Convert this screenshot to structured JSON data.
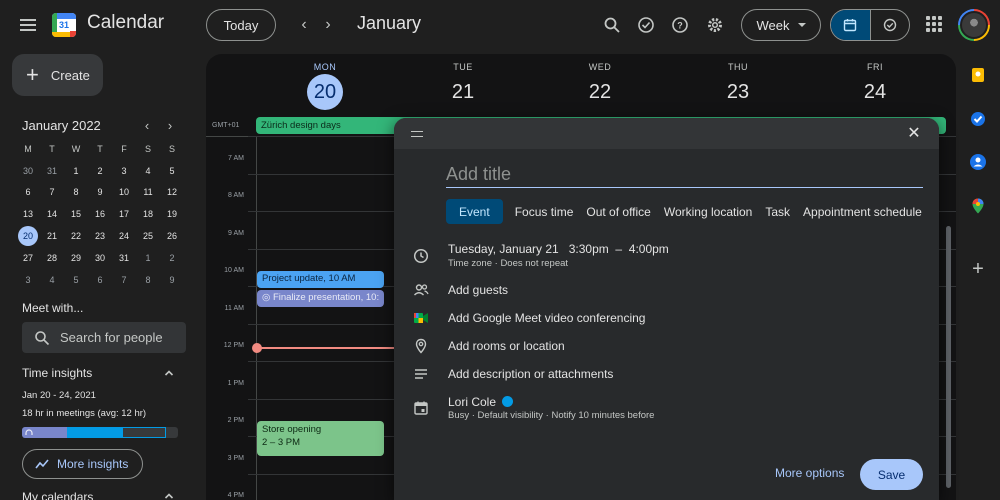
{
  "app": {
    "title": "Calendar",
    "logo_number": "31"
  },
  "toolbar": {
    "today_label": "Today",
    "prev_label": "‹",
    "next_label": "›",
    "month_title": "January",
    "view_label": "Week"
  },
  "sidebar": {
    "create_label": "Create",
    "mini_cal": {
      "title": "January 2022",
      "prev": "‹",
      "next": "›",
      "weekdays": [
        "M",
        "T",
        "W",
        "T",
        "F",
        "S",
        "S"
      ],
      "weeks": [
        [
          "30",
          "31",
          "1",
          "2",
          "3",
          "4",
          "5"
        ],
        [
          "6",
          "7",
          "8",
          "9",
          "10",
          "11",
          "12"
        ],
        [
          "13",
          "14",
          "15",
          "16",
          "17",
          "18",
          "19"
        ],
        [
          "20",
          "21",
          "22",
          "23",
          "24",
          "25",
          "26"
        ],
        [
          "27",
          "28",
          "29",
          "30",
          "31",
          "1",
          "2"
        ],
        [
          "3",
          "4",
          "5",
          "6",
          "7",
          "8",
          "9"
        ]
      ],
      "selected": "20"
    },
    "meet_with": {
      "label": "Meet with...",
      "search_placeholder": "Search for people"
    },
    "time_insights": {
      "label": "Time insights",
      "date_range": "Jan 20 - 24, 2021",
      "summary": "18 hr in meetings (avg: 12 hr)",
      "more_label": "More insights"
    },
    "my_calendars_label": "My calendars"
  },
  "week": {
    "days": [
      {
        "dow": "MON",
        "num": "20",
        "today": true
      },
      {
        "dow": "TUE",
        "num": "21"
      },
      {
        "dow": "WED",
        "num": "22"
      },
      {
        "dow": "THU",
        "num": "23"
      },
      {
        "dow": "FRI",
        "num": "24"
      }
    ],
    "timezone": "GMT+01",
    "allday_event": "Zürich design days",
    "hours": [
      "7 AM",
      "8 AM",
      "9 AM",
      "10 AM",
      "11 AM",
      "12 PM",
      "1 PM",
      "2 PM",
      "3 PM",
      "4 PM"
    ],
    "events": {
      "project_update": "Project update, 10 AM",
      "finalize": "Finalize presentation, 10:",
      "store_title": "Store opening",
      "store_time": "2 – 3 PM"
    }
  },
  "dialog": {
    "title_placeholder": "Add title",
    "types": [
      "Event",
      "Focus time",
      "Out of office",
      "Working location",
      "Task",
      "Appointment schedule"
    ],
    "active_type": "Event",
    "date_line": "Tuesday, January 21   3:30pm  –  4:00pm",
    "timezone_line": "Time zone · Does not repeat",
    "add_guests": "Add guests",
    "meet": "Add Google Meet video conferencing",
    "location": "Add rooms or location",
    "description": "Add description or attachments",
    "owner_name": "Lori Cole",
    "owner_sub": "Busy · Default visibility · Notify 10 minutes before",
    "more_options": "More options",
    "save": "Save"
  },
  "colors": {
    "accent": "#a8c7fa",
    "allday_event": "#33b679",
    "event_blue": "#4ba3f2",
    "event_purple": "#7986cb",
    "event_green": "#7cc48a",
    "now_line": "#f28b82"
  },
  "icons": [
    "menu-icon",
    "search-icon",
    "task-check-icon",
    "help-icon",
    "settings-icon",
    "calendar-view-icon",
    "tasks-view-icon",
    "apps-icon",
    "keep-icon",
    "tasks-icon",
    "contacts-icon",
    "maps-icon",
    "plus-icon",
    "clock-icon",
    "people-icon",
    "meet-icon",
    "location-icon",
    "notes-icon",
    "calendar-icon",
    "close-icon"
  ]
}
